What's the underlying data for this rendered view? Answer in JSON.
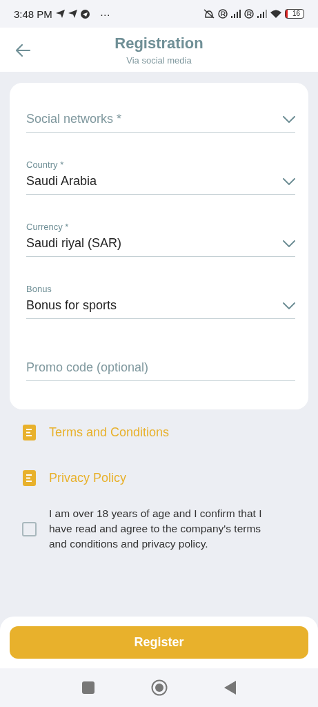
{
  "status_bar": {
    "time": "3:48 PM",
    "more": "···",
    "battery": "16"
  },
  "header": {
    "title": "Registration",
    "subtitle": "Via social media"
  },
  "form": {
    "fields": [
      {
        "kind": "select",
        "placeholder": "Social networks *"
      },
      {
        "kind": "select",
        "label": "Country *",
        "value": "Saudi Arabia"
      },
      {
        "kind": "select",
        "label": "Currency *",
        "value": "Saudi riyal (SAR)"
      },
      {
        "kind": "select",
        "label": "Bonus",
        "value": "Bonus for sports"
      },
      {
        "kind": "text",
        "placeholder": "Promo code (optional)"
      }
    ]
  },
  "links": [
    "Terms and Conditions",
    "Privacy Policy"
  ],
  "agreement": {
    "checked": false,
    "text": "I am over 18 years of age and I confirm that I have read and agree to the company's terms and conditions and privacy policy."
  },
  "register_button": "Register"
}
